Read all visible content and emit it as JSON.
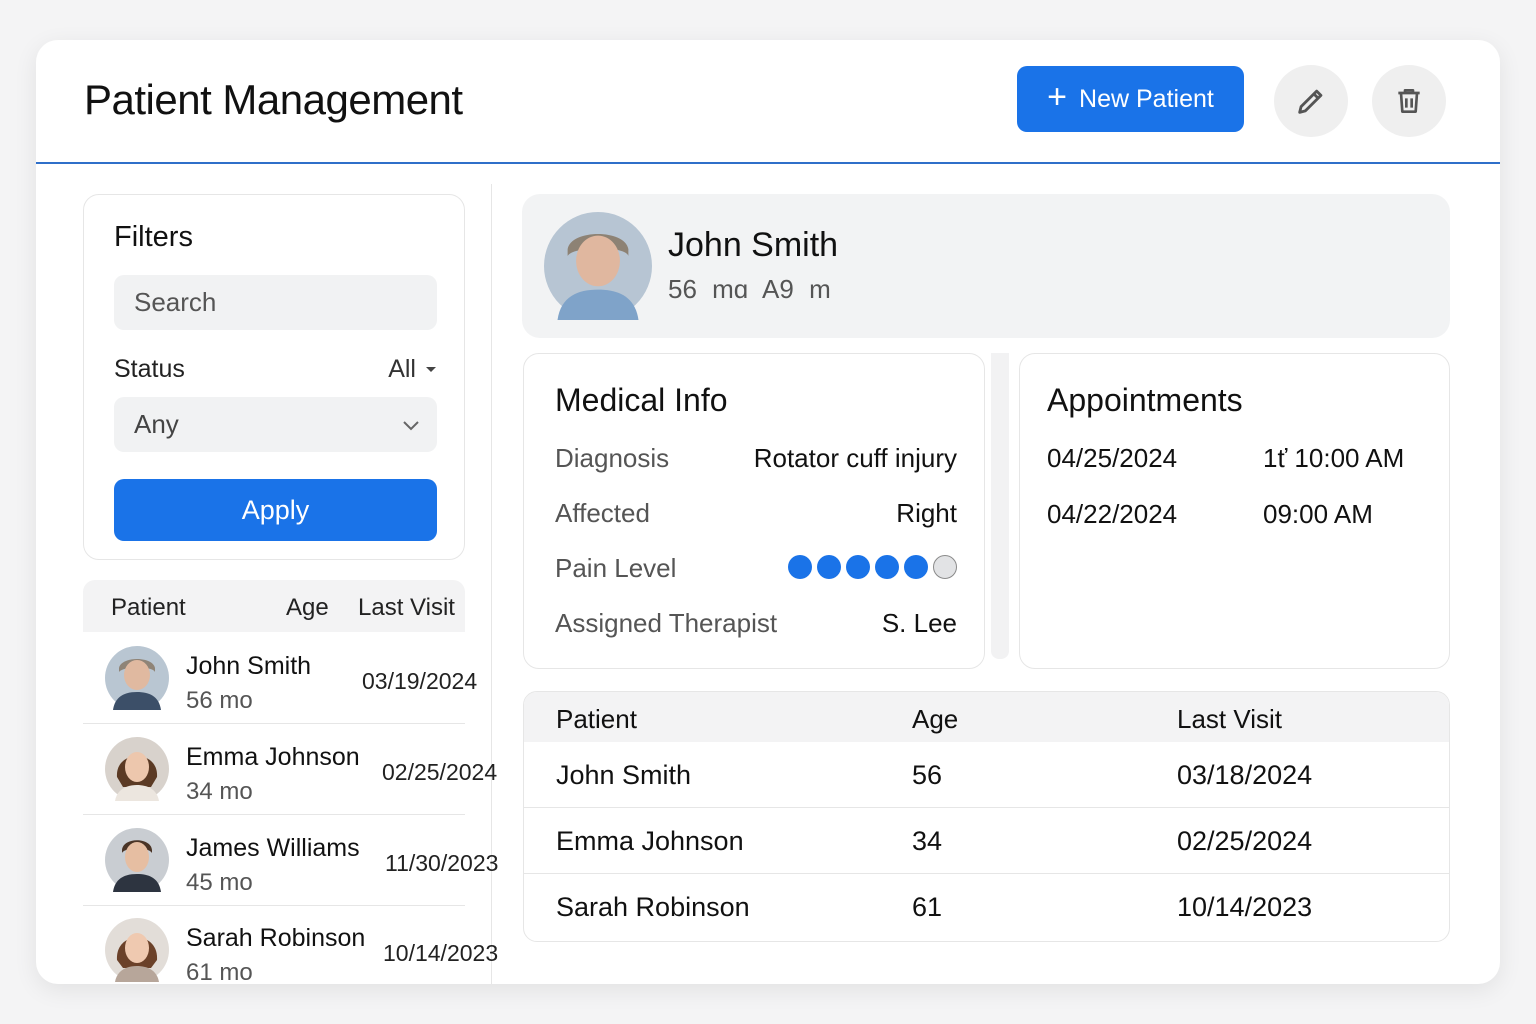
{
  "header": {
    "title": "Patient Management",
    "new_button": "New Patient",
    "new_button_icon": "plus-icon",
    "edit_icon": "pencil-icon",
    "delete_icon": "trash-icon"
  },
  "colors": {
    "accent": "#1a73e8",
    "header_rule": "#2f6fc9"
  },
  "filters": {
    "title": "Filters",
    "search_placeholder": "Search",
    "status_label": "Status",
    "status_value": "All",
    "select_value": "Any",
    "apply_label": "Apply"
  },
  "patient_list": {
    "columns": [
      "Patient",
      "Age",
      "Last Visit"
    ],
    "rows": [
      {
        "name": "John Smith",
        "age": "56 mo",
        "last_visit": "03/19/2024"
      },
      {
        "name": "Emma Johnson",
        "age": "34 mo",
        "last_visit": "02/25/2024"
      },
      {
        "name": "James Williams",
        "age": "45 mo",
        "last_visit": "11/30/2023"
      },
      {
        "name": "Sarah Robinson",
        "age": "61 mo",
        "last_visit": "10/14/2023"
      }
    ]
  },
  "profile": {
    "name": "John Smith",
    "subtitle": "56 mɑ A9 m"
  },
  "medical_info": {
    "title": "Medical Info",
    "rows": [
      {
        "label": "Diagnosis",
        "value": "Rotator cuff injury"
      },
      {
        "label": "Affected",
        "value": "Right"
      },
      {
        "label": "Pain Level",
        "value": ""
      },
      {
        "label": "Assigned Therapist",
        "value": "S. Lee"
      }
    ],
    "pain_level": 5,
    "pain_max": 6
  },
  "appointments": {
    "title": "Appointments",
    "items": [
      {
        "date": "04/25/2024",
        "time": "1ť 10:00 AM"
      },
      {
        "date": "04/22/2024",
        "time": "09:00 AM"
      }
    ]
  },
  "patient_table": {
    "columns": [
      "Patient",
      "Age",
      "Last Visit"
    ],
    "rows": [
      {
        "name": "John Smith",
        "age": "56",
        "last_visit": "03/18/2024"
      },
      {
        "name": "Emma Johnson",
        "age": "34",
        "last_visit": "02/25/2024"
      },
      {
        "name": "Sarah Robinson",
        "age": "61",
        "last_visit": "10/14/2023"
      }
    ]
  }
}
